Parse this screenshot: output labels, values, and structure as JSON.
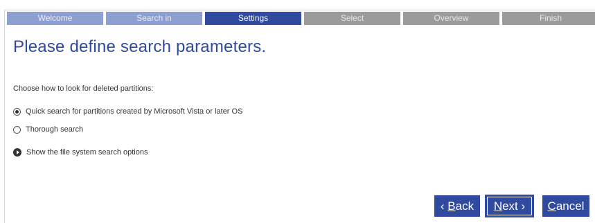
{
  "steps": [
    {
      "label": "Welcome",
      "state": "done"
    },
    {
      "label": "Search in",
      "state": "done"
    },
    {
      "label": "Settings",
      "state": "active"
    },
    {
      "label": "Select",
      "state": "pending"
    },
    {
      "label": "Overview",
      "state": "pending"
    },
    {
      "label": "Finish",
      "state": "pending"
    }
  ],
  "page": {
    "title": "Please define search parameters.",
    "prompt": "Choose how to look for deleted partitions:"
  },
  "options": {
    "quick": {
      "label": "Quick search for partitions created by Microsoft Vista or later OS",
      "checked": true
    },
    "thorough": {
      "label": "Thorough search",
      "checked": false
    },
    "fs_toggle": {
      "label": "Show the file system search options"
    }
  },
  "buttons": {
    "back": {
      "prefix": "‹ ",
      "mnemonic": "B",
      "rest": "ack"
    },
    "next": {
      "mnemonic": "N",
      "rest": "ext",
      "suffix": " ›"
    },
    "cancel": {
      "mnemonic": "C",
      "rest": "ancel"
    }
  },
  "colors": {
    "accent": "#2f4a9e",
    "step_done": "#8d9fd0",
    "step_pending": "#9b9b9b"
  }
}
